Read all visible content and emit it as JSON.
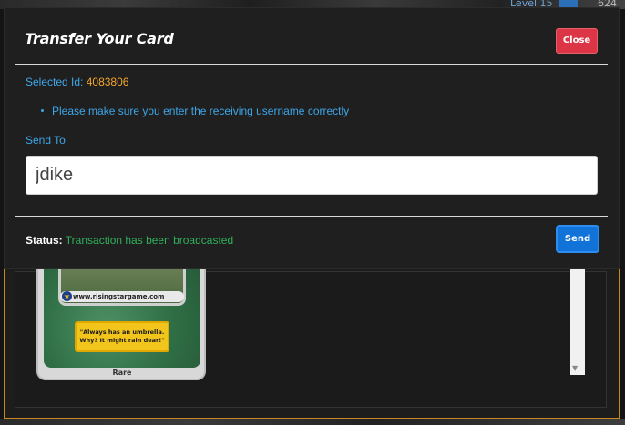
{
  "background": {
    "level_label": "Level 15",
    "count": "624",
    "card": {
      "url": "www.risingstargame.com",
      "quote": "\"Always has an umbrella. Why? It might rain dear!\"",
      "rarity": "Rare"
    }
  },
  "modal": {
    "title": "Transfer Your Card",
    "close_label": "Close",
    "selected_label": "Selected Id:",
    "selected_id": "4083806",
    "notice": "Please make sure you enter the receiving username correctly",
    "send_to_label": "Send To",
    "recipient_value": "jdike",
    "status_label": "Status:",
    "status_value": "Transaction has been broadcasted",
    "send_label": "Send"
  },
  "colors": {
    "accent_blue": "#3da6e8",
    "id_orange": "#f3a52b",
    "status_green": "#2fb15a",
    "close_red": "#dc3545",
    "send_blue": "#1173d8"
  }
}
